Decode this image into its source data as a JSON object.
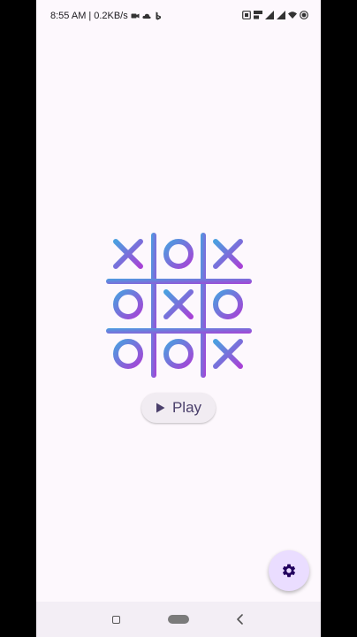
{
  "status_bar": {
    "time": "8:55 AM",
    "separator": "|",
    "net_speed": "0.2KB/s",
    "left_icons": [
      "video-camera-icon",
      "cloud-icon",
      "bing-icon"
    ],
    "right_icons": [
      "sim-icon",
      "volte-icon",
      "signal-icon",
      "signal-icon",
      "wifi-icon",
      "battery-icon"
    ]
  },
  "board": {
    "cells": [
      "X",
      "O",
      "X",
      "O",
      "X",
      "O",
      "O",
      "O",
      "X"
    ],
    "gradient_start": "#4a9fe0",
    "gradient_end": "#a742d6"
  },
  "play_button": {
    "label": "Play",
    "icon": "play-icon"
  },
  "settings_fab": {
    "icon": "gear-icon",
    "color": "#eaddff"
  },
  "nav_bar": {
    "buttons": [
      "recents-button",
      "home-button",
      "back-button"
    ]
  },
  "colors": {
    "background": "#fdf8fd",
    "primary_dark": "#4a3f6b",
    "fab_icon": "#21005d"
  }
}
